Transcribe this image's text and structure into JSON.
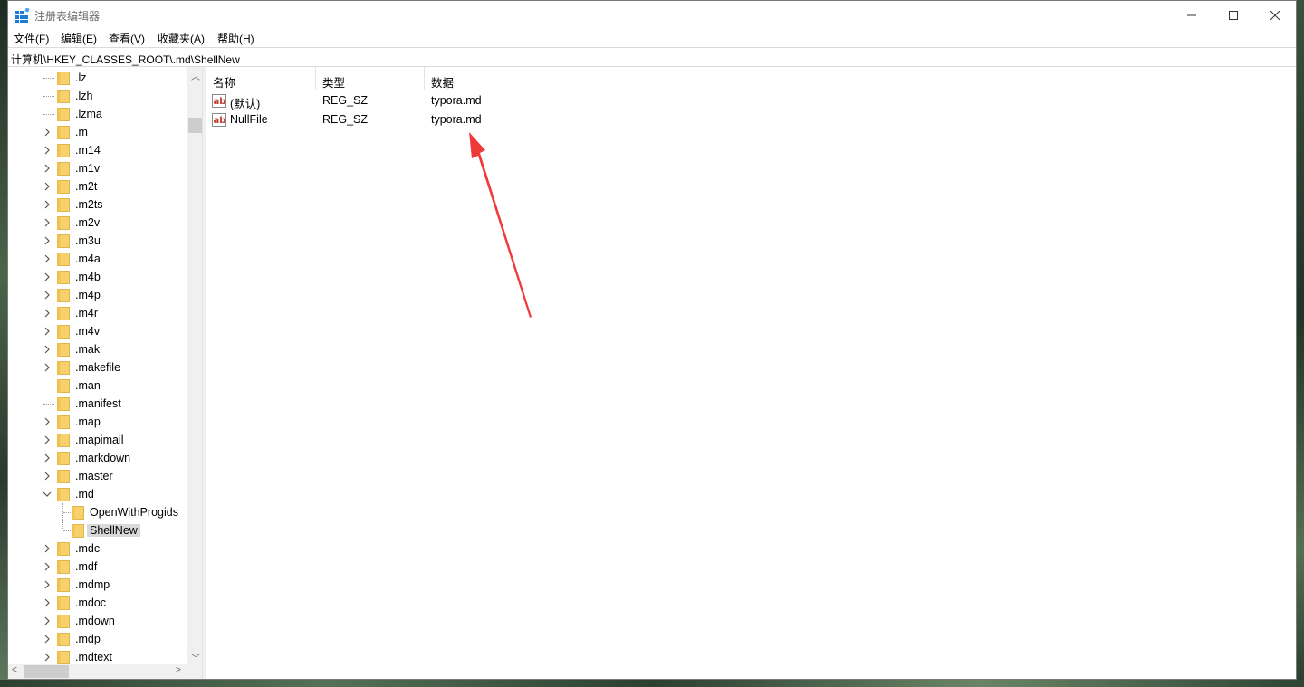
{
  "window": {
    "title": "注册表编辑器"
  },
  "menu": [
    "文件(F)",
    "编辑(E)",
    "查看(V)",
    "收藏夹(A)",
    "帮助(H)"
  ],
  "address": "计算机\\HKEY_CLASSES_ROOT\\.md\\ShellNew",
  "tree": {
    "items": [
      {
        "label": ".lz",
        "expander": "none",
        "level": 0
      },
      {
        "label": ".lzh",
        "expander": "none",
        "level": 0
      },
      {
        "label": ".lzma",
        "expander": "none",
        "level": 0
      },
      {
        "label": ".m",
        "expander": "collapsed",
        "level": 0
      },
      {
        "label": ".m14",
        "expander": "collapsed",
        "level": 0
      },
      {
        "label": ".m1v",
        "expander": "collapsed",
        "level": 0
      },
      {
        "label": ".m2t",
        "expander": "collapsed",
        "level": 0
      },
      {
        "label": ".m2ts",
        "expander": "collapsed",
        "level": 0
      },
      {
        "label": ".m2v",
        "expander": "collapsed",
        "level": 0
      },
      {
        "label": ".m3u",
        "expander": "collapsed",
        "level": 0
      },
      {
        "label": ".m4a",
        "expander": "collapsed",
        "level": 0
      },
      {
        "label": ".m4b",
        "expander": "collapsed",
        "level": 0
      },
      {
        "label": ".m4p",
        "expander": "collapsed",
        "level": 0
      },
      {
        "label": ".m4r",
        "expander": "collapsed",
        "level": 0
      },
      {
        "label": ".m4v",
        "expander": "collapsed",
        "level": 0
      },
      {
        "label": ".mak",
        "expander": "collapsed",
        "level": 0
      },
      {
        "label": ".makefile",
        "expander": "collapsed",
        "level": 0
      },
      {
        "label": ".man",
        "expander": "none",
        "level": 0
      },
      {
        "label": ".manifest",
        "expander": "none",
        "level": 0
      },
      {
        "label": ".map",
        "expander": "collapsed",
        "level": 0
      },
      {
        "label": ".mapimail",
        "expander": "collapsed",
        "level": 0
      },
      {
        "label": ".markdown",
        "expander": "collapsed",
        "level": 0
      },
      {
        "label": ".master",
        "expander": "collapsed",
        "level": 0
      },
      {
        "label": ".md",
        "expander": "expanded",
        "level": 0
      },
      {
        "label": "OpenWithProgids",
        "expander": "none",
        "level": 1
      },
      {
        "label": "ShellNew",
        "expander": "none",
        "level": 1,
        "selected": true
      },
      {
        "label": ".mdc",
        "expander": "collapsed",
        "level": 0
      },
      {
        "label": ".mdf",
        "expander": "collapsed",
        "level": 0
      },
      {
        "label": ".mdmp",
        "expander": "collapsed",
        "level": 0
      },
      {
        "label": ".mdoc",
        "expander": "collapsed",
        "level": 0
      },
      {
        "label": ".mdown",
        "expander": "collapsed",
        "level": 0
      },
      {
        "label": ".mdp",
        "expander": "collapsed",
        "level": 0
      },
      {
        "label": ".mdtext",
        "expander": "collapsed",
        "level": 0
      }
    ]
  },
  "list": {
    "columns": [
      "名称",
      "类型",
      "数据"
    ],
    "rows": [
      {
        "name": "(默认)",
        "type": "REG_SZ",
        "data": "typora.md",
        "icon": "string-value-icon"
      },
      {
        "name": "NullFile",
        "type": "REG_SZ",
        "data": "typora.md",
        "icon": "string-value-icon"
      }
    ]
  },
  "colors": {
    "annotation_arrow": "#f03a3a",
    "folder": "#f7d16c",
    "selection": "#d9d9d9"
  }
}
